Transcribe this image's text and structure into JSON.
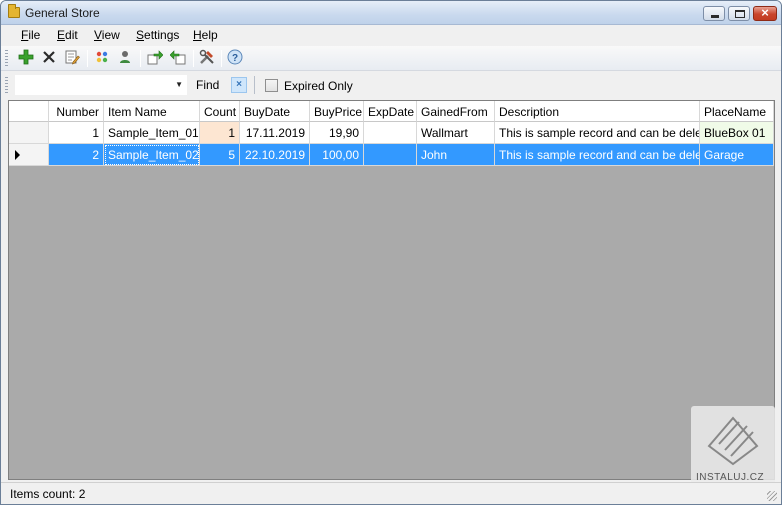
{
  "window": {
    "title": "General Store"
  },
  "menu": [
    {
      "key": "F",
      "rest": "ile"
    },
    {
      "key": "E",
      "rest": "dit"
    },
    {
      "key": "V",
      "rest": "iew"
    },
    {
      "key": "S",
      "rest": "ettings"
    },
    {
      "key": "H",
      "rest": "elp"
    }
  ],
  "toolbar": {
    "icons": [
      "add-icon",
      "delete-icon",
      "edit-icon",
      "palette-icon",
      "user-icon",
      "export-icon",
      "import-icon",
      "tools-icon",
      "help-icon"
    ]
  },
  "filter": {
    "search_value": "",
    "find_label": "Find",
    "clear_glyph": "×",
    "expired_label": "Expired Only",
    "expired_checked": false
  },
  "grid": {
    "columns": [
      "Number",
      "Item Name",
      "Count",
      "BuyDate",
      "BuyPrice",
      "ExpDate",
      "GainedFrom",
      "Description",
      "PlaceName"
    ],
    "rows": [
      {
        "Number": "1",
        "ItemName": "Sample_Item_01",
        "Count": "1",
        "BuyDate": "17.11.2019",
        "BuyPrice": "19,90",
        "ExpDate": "",
        "GainedFrom": "Wallmart",
        "Description": "This is sample record and can be deleted.",
        "PlaceName": "BlueBox 01"
      },
      {
        "Number": "2",
        "ItemName": "Sample_Item_02",
        "Count": "5",
        "BuyDate": "22.10.2019",
        "BuyPrice": "100,00",
        "ExpDate": "",
        "GainedFrom": "John",
        "Description": "This is sample record and can be deleted.",
        "PlaceName": "Garage"
      }
    ],
    "selected_row": 1
  },
  "status": {
    "text": "Items count: 2"
  },
  "watermark": {
    "text": "INSTALUJ.CZ"
  },
  "colors": {
    "selection": "#3399ff",
    "grid_background": "#aaaaaa",
    "count_highlight": "#fde6d2"
  }
}
